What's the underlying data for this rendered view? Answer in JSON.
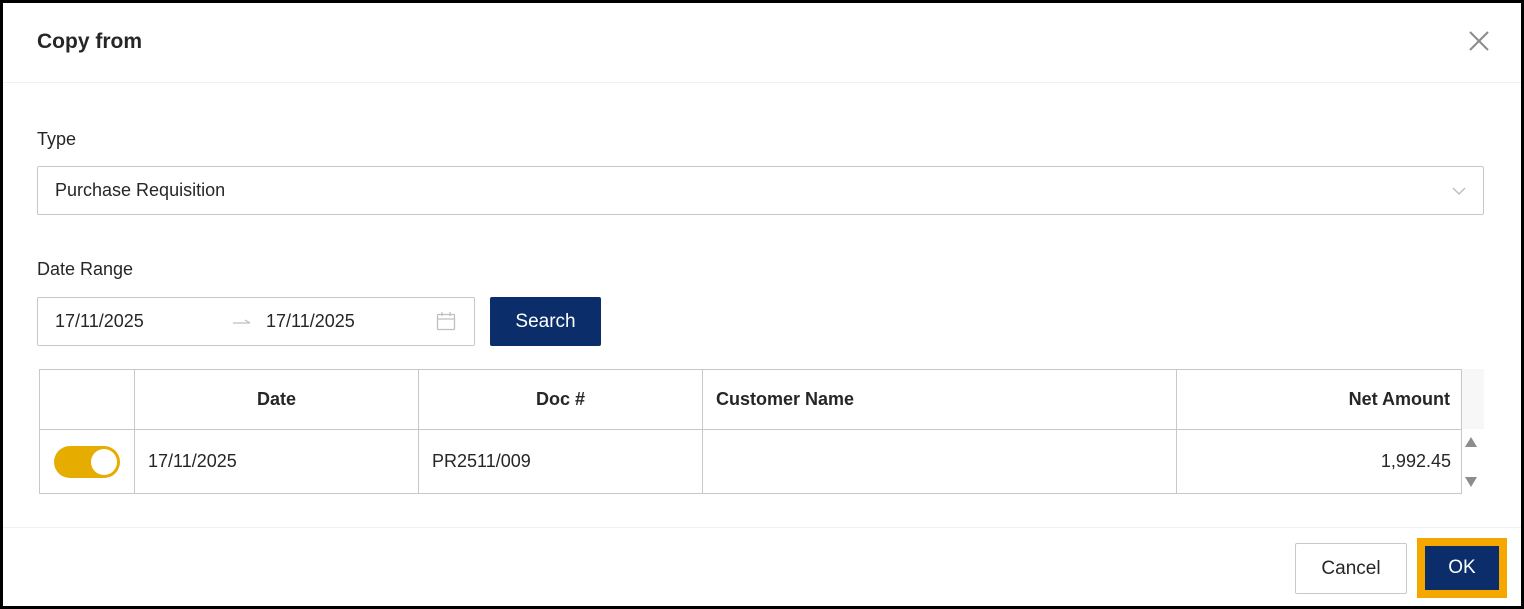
{
  "dialog": {
    "title": "Copy from"
  },
  "type_field": {
    "label": "Type",
    "value": "Purchase Requisition"
  },
  "date_range": {
    "label": "Date Range",
    "start": "17/11/2025",
    "end": "17/11/2025",
    "search_label": "Search"
  },
  "table": {
    "columns": [
      "",
      "Date",
      "Doc #",
      "Customer Name",
      "Net Amount"
    ],
    "rows": [
      {
        "selected": true,
        "date": "17/11/2025",
        "doc_no": "PR2511/009",
        "customer_name": "",
        "net_amount": "1,992.45"
      }
    ]
  },
  "footer": {
    "cancel_label": "Cancel",
    "ok_label": "OK"
  },
  "colors": {
    "primary": "#0b2e6b",
    "toggle_on": "#e6ad00",
    "focus_outline": "#f5a700"
  },
  "icons": {
    "close": "close-icon",
    "chevron": "chevron-down-icon",
    "range_separator": "arrow-right-icon",
    "calendar": "calendar-icon",
    "scroll_up": "caret-up-icon",
    "scroll_down": "caret-down-icon"
  }
}
